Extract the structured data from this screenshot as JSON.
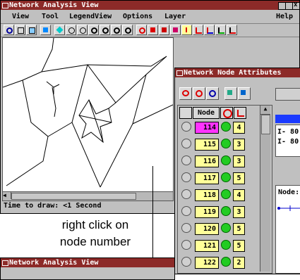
{
  "main_window": {
    "title": "Network Analysis View",
    "menus": [
      "View",
      "Tool",
      "LegendView",
      "Options",
      "Layer",
      "Help"
    ],
    "status": "Time to draw: <1 Second"
  },
  "caption": {
    "line1": "right click on",
    "line2": "node number"
  },
  "second_window": {
    "title": "Network Analysis View"
  },
  "attr_window": {
    "title": "Network Node Attributes",
    "header": {
      "node": "Node"
    },
    "rows": [
      {
        "node": "114",
        "value": "4",
        "selected": true
      },
      {
        "node": "115",
        "value": "3",
        "selected": false
      },
      {
        "node": "116",
        "value": "3",
        "selected": false
      },
      {
        "node": "117",
        "value": "5",
        "selected": false
      },
      {
        "node": "118",
        "value": "4",
        "selected": false
      },
      {
        "node": "119",
        "value": "3",
        "selected": false
      },
      {
        "node": "120",
        "value": "5",
        "selected": false
      },
      {
        "node": "121",
        "value": "5",
        "selected": false
      },
      {
        "node": "122",
        "value": "2",
        "selected": false
      }
    ],
    "side_labels": [
      "I- 80",
      "I- 80"
    ],
    "node_label": "Node:"
  },
  "colors": {
    "titlebar": "#8c2a28",
    "selected_node": "#ff33ff",
    "node_cell": "#ffff99",
    "indicator": "#22cc22"
  }
}
